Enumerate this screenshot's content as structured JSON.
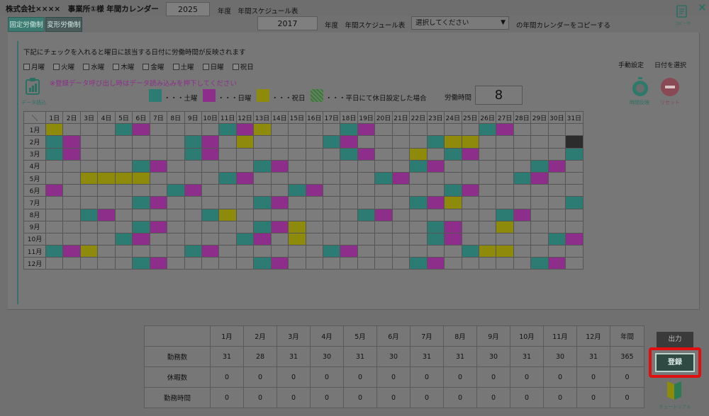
{
  "header": {
    "title": "株式会社××××　事業所①様 年間カレンダー",
    "year_main": "2025",
    "year_main_suffix": "年度　年間スケジュール表",
    "copy_icon_label": "コピー中",
    "close_icon": "×"
  },
  "tabs": [
    {
      "label": "固定労働制"
    },
    {
      "label": "変形労働制"
    }
  ],
  "copy_row": {
    "year": "2017",
    "suffix": "年度　年間スケジュール表",
    "select_value": "選択してください",
    "tail": "の年間カレンダーをコピーする"
  },
  "instructions": {
    "checkline": "下記にチェックを入れると曜日に該当する日付に労働時間が反映されます",
    "load_notice": "※登録データ呼び出し時はデータ読み込みを押下してください"
  },
  "weekday_checks": [
    "月曜",
    "火曜",
    "水曜",
    "木曜",
    "金曜",
    "土曜",
    "日曜",
    "祝日"
  ],
  "mode_labels": {
    "manual": "手動設定",
    "select_date": "日付を選択"
  },
  "data_load_label": "データ読込",
  "legend": [
    {
      "key": "sat",
      "label": "・・・土曜",
      "color": "#2c7c73"
    },
    {
      "key": "sun",
      "label": "・・・日曜",
      "color": "#8d2e8b"
    },
    {
      "key": "hol",
      "label": "・・・祝日",
      "color": "#8e8a0c"
    },
    {
      "key": "off",
      "label": "・・・平日にて休日設定した場合",
      "color": "#4d7d4d"
    }
  ],
  "work_hours": {
    "label": "労働時間",
    "value": "8"
  },
  "buttons": {
    "reflect": "時間反映",
    "reset": "リセット",
    "output": "出力",
    "register": "登録",
    "tutorial": "チュートリアル"
  },
  "calendar": {
    "corner": "＼",
    "days": [
      "1日",
      "2日",
      "3日",
      "4日",
      "5日",
      "6日",
      "7日",
      "8日",
      "9日",
      "10日",
      "11日",
      "12日",
      "13日",
      "14日",
      "15日",
      "16日",
      "17日",
      "18日",
      "19日",
      "20日",
      "21日",
      "22日",
      "23日",
      "24日",
      "25日",
      "26日",
      "27日",
      "28日",
      "29日",
      "30日",
      "31日"
    ],
    "months": [
      {
        "label": "1月",
        "cells": "y...tp....tpy....tp......tp....."
      },
      {
        "label": "2月",
        "cells": "tp......tp.y....tp....tyy.....kkk"
      },
      {
        "label": "3月",
        "cells": "tp......tp.......tp..y.tp.....tp."
      },
      {
        "label": "4月",
        "cells": ".....tp.....tp.......tp.....tp..yk"
      },
      {
        "label": "5月",
        "cells": "..yyyy....tp.......tp......tp....t"
      },
      {
        "label": "6月",
        "cells": "p......tp.....tp.......tp......tp."
      },
      {
        "label": "7月",
        "cells": ".....tp.....tp.......tpy......tp.."
      },
      {
        "label": "8月",
        "cells": "..tp.....ty.......tp......tp.....tp"
      },
      {
        "label": "9月",
        "cells": ".....tp.....tpy.......tp..y......tp"
      },
      {
        "label": "10月",
        "cells": "....tp.....tp.y.......tp.....tp..."
      },
      {
        "label": "11月",
        "cells": "tpy.....tp......tp......tyy.....tp"
      },
      {
        "label": "12月",
        "cells": ".....tp.....tp.......tp.....tp...tk"
      }
    ]
  },
  "summary": {
    "months": [
      "1月",
      "2月",
      "3月",
      "4月",
      "5月",
      "6月",
      "7月",
      "8月",
      "9月",
      "10月",
      "11月",
      "12月",
      "年間"
    ],
    "rows": [
      {
        "label": "勤務数",
        "values": [
          "31",
          "28",
          "31",
          "30",
          "31",
          "30",
          "31",
          "31",
          "30",
          "31",
          "30",
          "31",
          "365"
        ]
      },
      {
        "label": "休暇数",
        "values": [
          "0",
          "0",
          "0",
          "0",
          "0",
          "0",
          "0",
          "0",
          "0",
          "0",
          "0",
          "0",
          "0"
        ]
      },
      {
        "label": "勤務時間",
        "values": [
          "0",
          "0",
          "0",
          "0",
          "0",
          "0",
          "0",
          "0",
          "0",
          "0",
          "0",
          "0",
          "0"
        ]
      }
    ]
  }
}
